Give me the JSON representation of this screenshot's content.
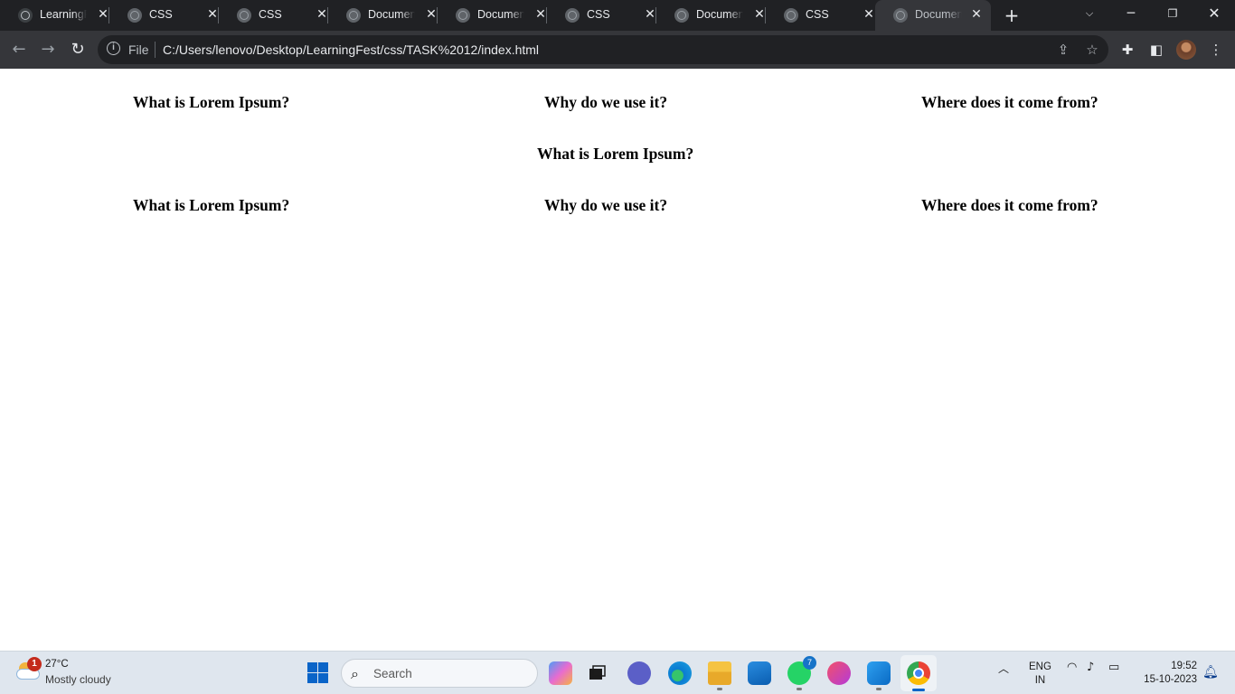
{
  "browser": {
    "tabs": [
      {
        "title": "LearningFest",
        "favicon": "github-icon"
      },
      {
        "title": "CSS",
        "favicon": "globe-icon"
      },
      {
        "title": "CSS",
        "favicon": "globe-icon"
      },
      {
        "title": "Document",
        "favicon": "globe-icon"
      },
      {
        "title": "Document",
        "favicon": "globe-icon"
      },
      {
        "title": "CSS",
        "favicon": "globe-icon"
      },
      {
        "title": "Document",
        "favicon": "globe-icon"
      },
      {
        "title": "CSS",
        "favicon": "globe-icon"
      },
      {
        "title": "Document",
        "favicon": "globe-icon",
        "active": true
      }
    ],
    "close_glyph": "✕",
    "new_tab_glyph": "+",
    "address": {
      "scheme_label": "File",
      "url": "C:/Users/lenovo/Desktop/LearningFest/css/TASK%2012/index.html"
    }
  },
  "page": {
    "row1": [
      "What is Lorem Ipsum?",
      "Why do we use it?",
      "Where does it come from?"
    ],
    "row2": [
      "What is Lorem Ipsum?"
    ],
    "row3": [
      "What is Lorem Ipsum?",
      "Why do we use it?",
      "Where does it come from?"
    ]
  },
  "taskbar": {
    "weather": {
      "temp": "27°C",
      "condition": "Mostly cloudy",
      "badge": "1"
    },
    "search_placeholder": "Search",
    "whatsapp_badge": "7",
    "language": {
      "line1": "ENG",
      "line2": "IN"
    },
    "clock": {
      "time": "19:52",
      "date": "15-10-2023"
    }
  },
  "colors": {
    "tabstrip_bg": "#202124",
    "toolbar_bg": "#35363a",
    "accent": "#0a64c8"
  }
}
